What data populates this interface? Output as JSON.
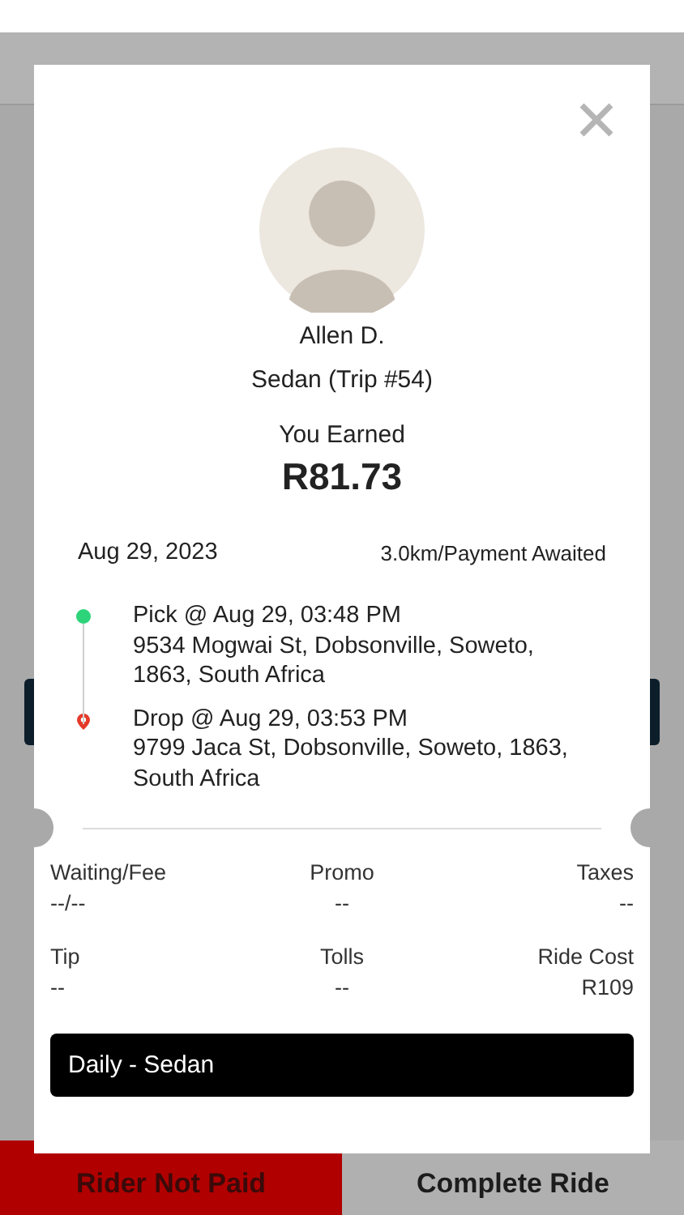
{
  "rider": {
    "name": "Allen D.",
    "vehicle": "Sedan (Trip #54)"
  },
  "earnings": {
    "label": "You Earned",
    "amount": "R81.73"
  },
  "trip": {
    "date": "Aug 29, 2023",
    "summary": "3.0km/Payment Awaited"
  },
  "stops": [
    {
      "kind": "pickup",
      "title": "Pick @ Aug 29, 03:48 PM",
      "address": "9534 Mogwai St, Dobsonville, Soweto, 1863, South Africa"
    },
    {
      "kind": "drop",
      "title": "Drop @ Aug 29, 03:53 PM",
      "address": "9799 Jaca St, Dobsonville, Soweto, 1863, South Africa"
    }
  ],
  "fees": [
    {
      "label": "Waiting/Fee",
      "value": "--/--"
    },
    {
      "label": "Promo",
      "value": "--"
    },
    {
      "label": "Taxes",
      "value": "--"
    },
    {
      "label": "Tip",
      "value": "--"
    },
    {
      "label": "Tolls",
      "value": "--"
    },
    {
      "label": "Ride Cost",
      "value": "R109"
    }
  ],
  "plan": "Daily - Sedan",
  "actions": [
    {
      "kind": "danger",
      "label": "Rider Not Paid"
    },
    {
      "kind": "primary",
      "label": "Complete Ride"
    }
  ]
}
